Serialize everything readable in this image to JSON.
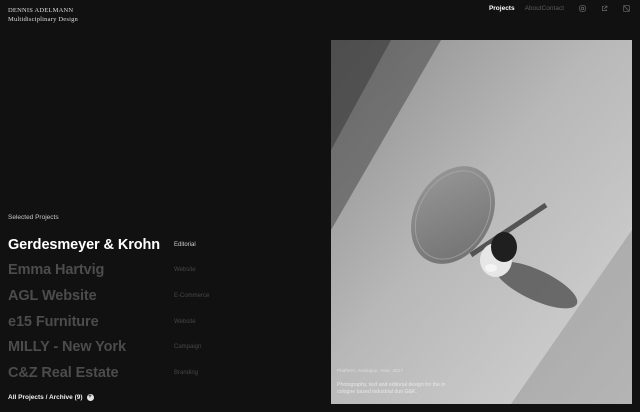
{
  "brand": {
    "name": "DENNIS ADELMANN",
    "tagline": "Multidisciplinary Design"
  },
  "nav": {
    "projects": "Projects",
    "about": "About",
    "contact": "Contact",
    "icons": [
      "instagram-icon",
      "external-link-icon",
      "theme-toggle-icon"
    ]
  },
  "sidebar": {
    "section_label": "Selected Projects",
    "projects": [
      {
        "name": "Gerdesmeyer & Krohn",
        "category": "Editorial",
        "active": true
      },
      {
        "name": "Emma Hartvig",
        "category": "Website",
        "active": false
      },
      {
        "name": "AGL Website",
        "category": "E-Commerce",
        "active": false
      },
      {
        "name": "e15 Furniture",
        "category": "Website",
        "active": false
      },
      {
        "name": "MILLY - New York",
        "category": "Campaign",
        "active": false
      },
      {
        "name": "C&Z Real Estate",
        "category": "Branding",
        "active": false
      }
    ],
    "all_projects": "All Projects / Archive (9)"
  },
  "hero": {
    "meta": "Platform: Analogue, Year: 2017",
    "description": "Photography, text and editorial design for the in cologne based industrial duo G&K."
  },
  "colors": {
    "background": "#111111",
    "text_active": "#ffffff",
    "text_inactive": "#4c4c4c"
  }
}
